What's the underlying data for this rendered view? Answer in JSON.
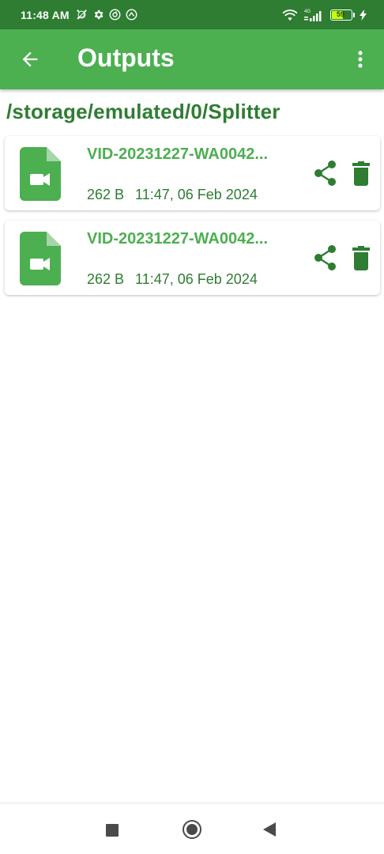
{
  "status_bar": {
    "time": "11:48 AM",
    "left_icons": [
      "alarm-off-icon",
      "settings-icon",
      "app-icon",
      "app-icon"
    ],
    "network": "4G",
    "battery_level": "59"
  },
  "app_bar": {
    "title": "Outputs",
    "back_icon": "arrow-left-icon",
    "menu_icon": "more-vert-icon"
  },
  "path": "/storage/emulated/0/Splitter",
  "files": [
    {
      "name": "VID-20231227-WA0042...",
      "size": "262 B",
      "modified": "11:47, 06 Feb 2024",
      "icon": "video-file-icon"
    },
    {
      "name": "VID-20231227-WA0042...",
      "size": "262 B",
      "modified": "11:47, 06 Feb 2024",
      "icon": "video-file-icon"
    }
  ],
  "colors": {
    "status_bar": "#2e7d32",
    "app_bar": "#4caf50",
    "accent_dark": "#2e7d32",
    "accent": "#4caf50"
  },
  "nav_bar": [
    "recents-button",
    "home-button",
    "back-button"
  ]
}
